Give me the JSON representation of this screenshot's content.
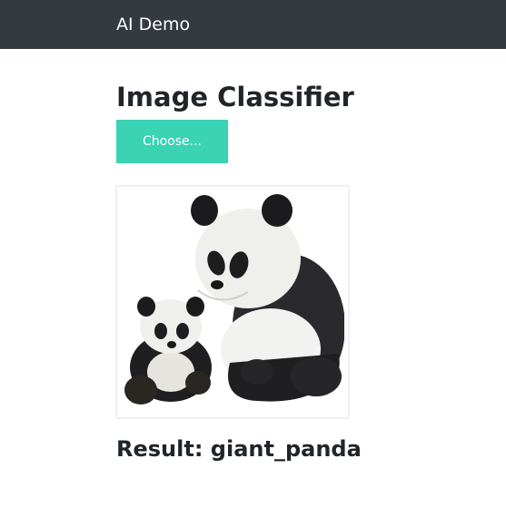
{
  "navbar": {
    "brand": "AI Demo",
    "background": "#343a40"
  },
  "main": {
    "title": "Image Classifier",
    "choose_label": "Choose...",
    "choose_color": "#3ad3b3",
    "image_icon": "giant-panda-photo",
    "result_prefix": "Result: ",
    "result_value": "giant_panda"
  }
}
